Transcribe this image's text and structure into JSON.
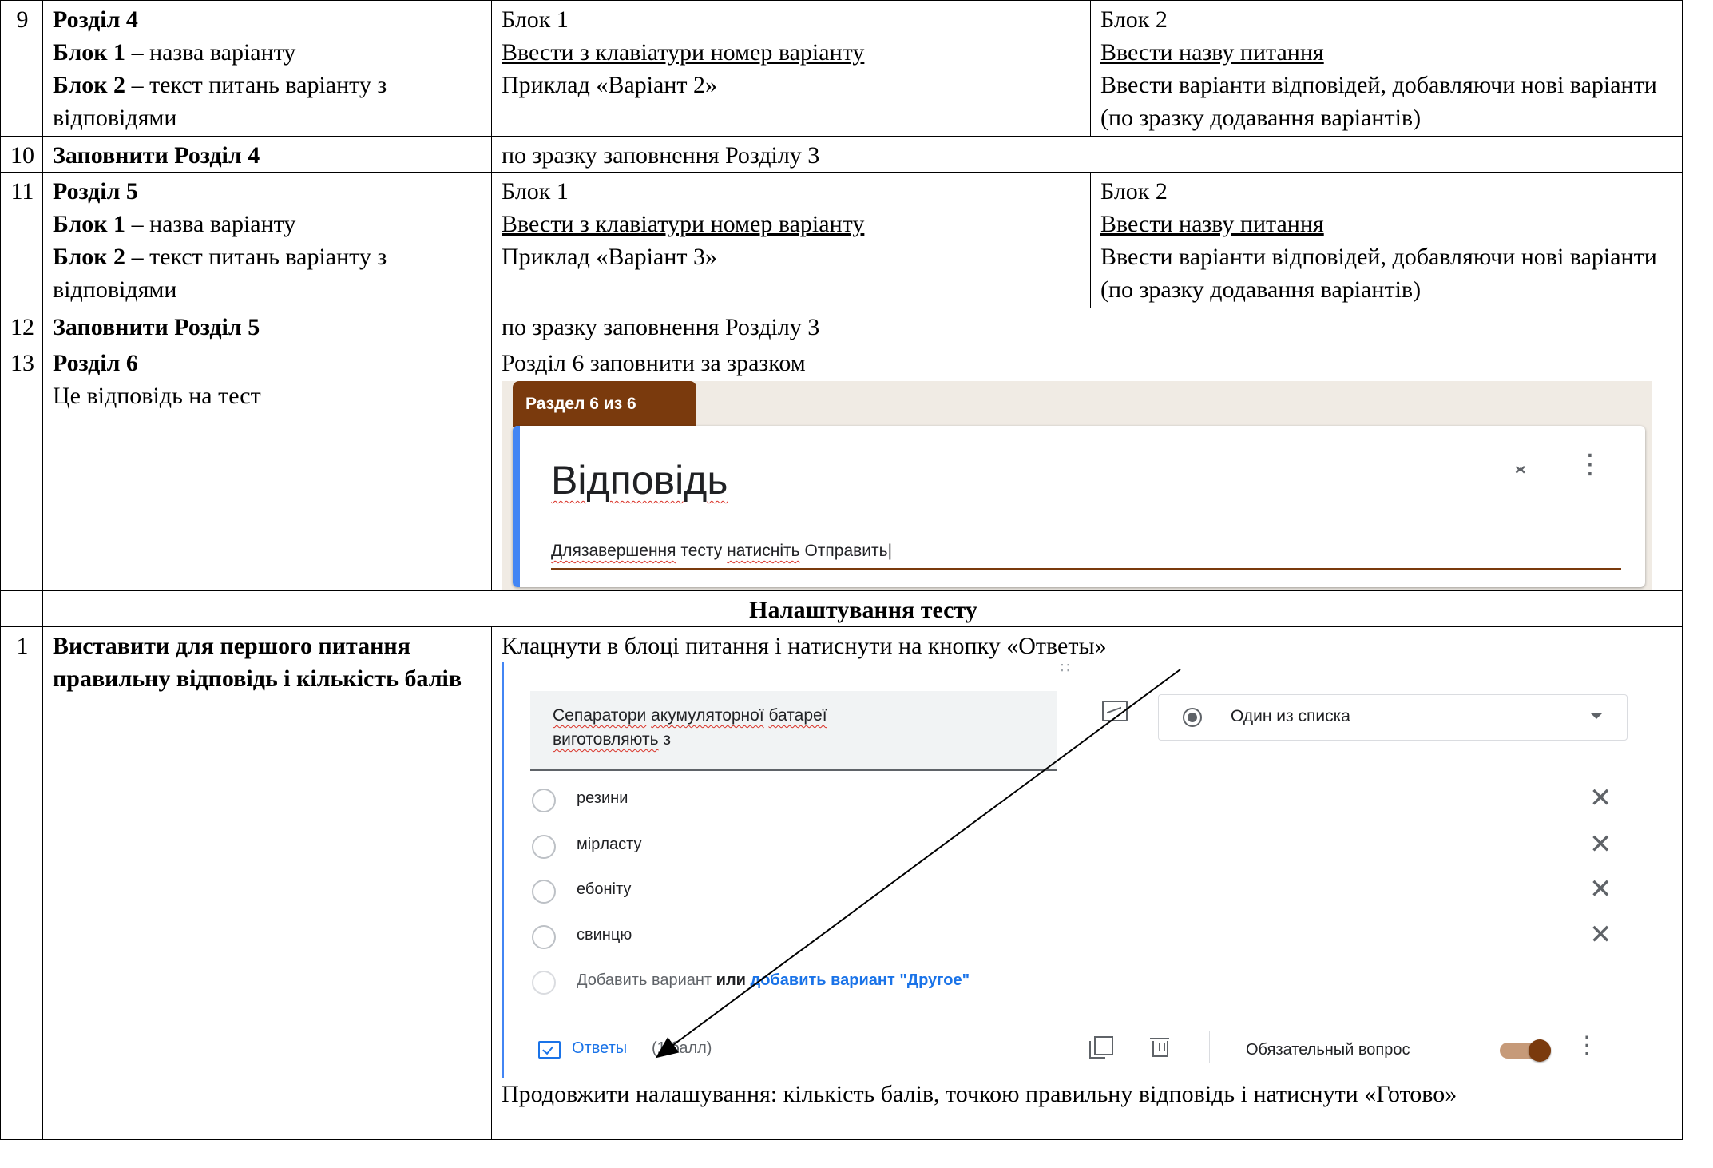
{
  "rows": [
    {
      "num": "9",
      "left": {
        "title": "Розділ 4",
        "b1_label": "Блок 1",
        "b1_text": " – назва варіанту",
        "b2_label": "Блок 2",
        "b2_text": " – текст питань варіанту з відповідями"
      },
      "mid": {
        "block": "Блок 1",
        "link": "Ввести з клавіатури номер варіанту",
        "example": "Приклад «Варіант 2»"
      },
      "right": {
        "block": "Блок 2",
        "link": "Ввести назву питання",
        "text": "Ввести варіанти відповідей, добавляючи нові варіанти (по зразку додавання варіантів)"
      }
    },
    {
      "num": "10",
      "left": "Заповнити Розділ 4",
      "right": "по зразку заповнення Розділу 3"
    },
    {
      "num": "11",
      "left": {
        "title": "Розділ 5",
        "b1_label": "Блок 1",
        "b1_text": " – назва варіанту",
        "b2_label": "Блок 2",
        "b2_text": " – текст питань варіанту з відповідями"
      },
      "mid": {
        "block": "Блок 1",
        "link": "Ввести з клавіатури номер варіанту",
        "example": "Приклад «Варіант 3»"
      },
      "right": {
        "block": "Блок 2",
        "link": "Ввести назву питання",
        "text": "Ввести варіанти відповідей, добавляючи нові варіанти (по зразку додавання варіантів)"
      }
    },
    {
      "num": "12",
      "left": "Заповнити Розділ 5",
      "right": "по зразку заповнення Розділу 3"
    },
    {
      "num": "13",
      "left_title": "Розділ 6",
      "left_text": "Це відповідь на тест",
      "right_text": "Розділ 6 заповнити за зразком",
      "screenshot": {
        "tab_label": "Раздел 6 из 6",
        "title": "Відповідь",
        "desc_w1": "Длязавершення",
        "desc_w2": " тесту ",
        "desc_w3": "натисніть",
        "desc_w4": " Отправить",
        "collapse_icon": "⌄⌃",
        "more_icon": "⋮"
      }
    },
    {
      "header": "Налаштування тесту"
    },
    {
      "num": "1",
      "left": "Виставити для першого питання правильну відповідь і кількість балів",
      "right_top": "Клацнути в блоці питання і натиснути на кнопку «Ответы»",
      "right_bottom": "Продовжити налашування: кількість балів, точкою правильну відповідь і натиснути «Готово»",
      "question": {
        "text_w1": "Сепаратори",
        "text_w2": "акумуляторної",
        "text_w3": "батареї",
        "text_w4": "виготовляють",
        "text_w5": " з",
        "type": "Один из списка",
        "options": [
          "резини",
          "мipласту",
          "ебоніту",
          "свинцю"
        ],
        "add_option": "Добавить вариант",
        "or": " или ",
        "add_other": "добавить вариант \"Другое\"",
        "answers": "Ответы",
        "points": "(1 балл)",
        "required": "Обязательный вопрос",
        "drag_icon": "∷",
        "remove_icon": "✕",
        "more_icon": "⋮"
      }
    }
  ]
}
